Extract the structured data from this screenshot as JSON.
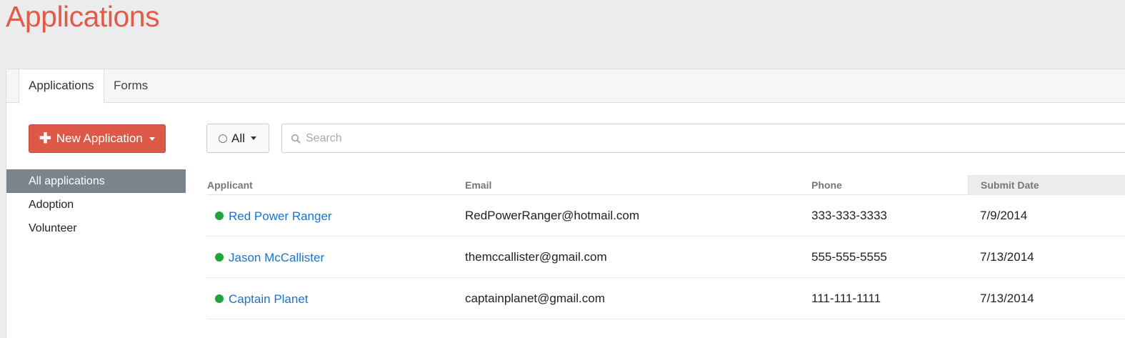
{
  "page": {
    "title": "Applications"
  },
  "tabs": [
    {
      "label": "Applications",
      "active": true
    },
    {
      "label": "Forms",
      "active": false
    }
  ],
  "new_button": {
    "label": "New Application",
    "icon": "plus-icon",
    "color": "#dd5846"
  },
  "sidebar": {
    "items": [
      {
        "label": "All applications",
        "active": true
      },
      {
        "label": "Adoption",
        "active": false
      },
      {
        "label": "Volunteer",
        "active": false
      }
    ]
  },
  "filter": {
    "label": "All"
  },
  "search": {
    "placeholder": "Search",
    "value": ""
  },
  "table": {
    "headers": {
      "applicant": "Applicant",
      "email": "Email",
      "phone": "Phone",
      "submit_date": "Submit Date"
    },
    "rows": [
      {
        "applicant": "Red Power Ranger",
        "email": "RedPowerRanger@hotmail.com",
        "phone": "333-333-3333",
        "submit_date": "7/9/2014",
        "status_color": "#1fa53a"
      },
      {
        "applicant": "Jason McCallister",
        "email": "themccallister@gmail.com",
        "phone": "555-555-5555",
        "submit_date": "7/13/2014",
        "status_color": "#1fa53a"
      },
      {
        "applicant": "Captain Planet",
        "email": "captainplanet@gmail.com",
        "phone": "111-111-1111",
        "submit_date": "7/13/2014",
        "status_color": "#1fa53a"
      }
    ]
  },
  "colors": {
    "accent": "#e05c4a",
    "link": "#1874d0",
    "sidebar_active": "#7b838d"
  }
}
